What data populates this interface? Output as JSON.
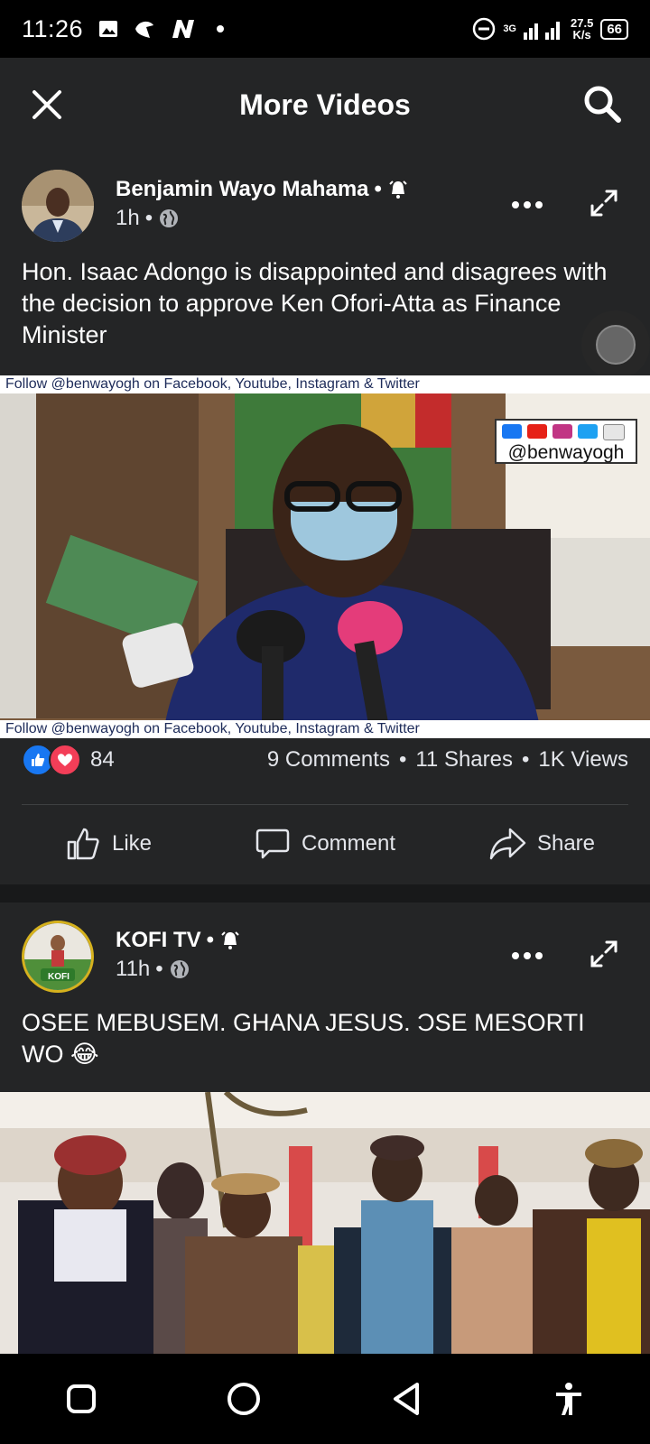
{
  "status_bar": {
    "time": "11:26",
    "network_type": "3G",
    "net_speed_value": "27.5",
    "net_speed_unit": "K/s",
    "battery": "66"
  },
  "header": {
    "title": "More Videos",
    "close_icon": "close-icon",
    "search_icon": "search-icon"
  },
  "posts": [
    {
      "author": "Benjamin Wayo Mahama",
      "time": "1h",
      "text": "Hon. Isaac Adongo is disappointed and disagrees with the decision to approve Ken Ofori-Atta as Finance Minister",
      "video_ticker": "Follow @benwayogh on Facebook, Youtube, Instagram & Twitter",
      "video_handle": "@benwayogh",
      "reaction_count": "84",
      "comments": "9 Comments",
      "shares": "11 Shares",
      "views": "1K Views",
      "actions": {
        "like": "Like",
        "comment": "Comment",
        "share": "Share"
      }
    },
    {
      "author": "KOFI TV",
      "time": "11h",
      "text": "OSEE MEBUSEM. GHANA JESUS. ƆSE MESORTI WO 😂",
      "avatar_label": "KOFI"
    }
  ],
  "colors": {
    "background": "#18191a",
    "card": "#242526",
    "like_blue": "#1877f2",
    "love_red": "#f33e58"
  }
}
